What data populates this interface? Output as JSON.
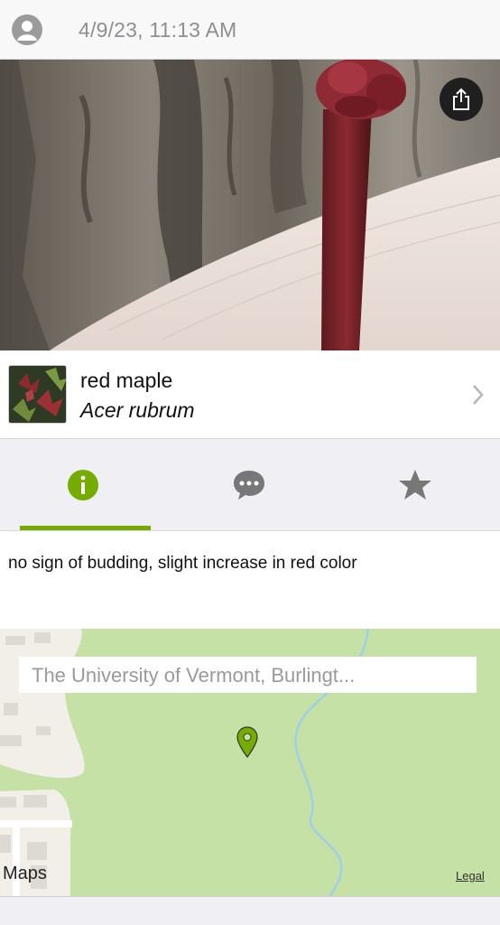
{
  "header": {
    "avatar_icon": "user-avatar-icon",
    "timestamp": "4/9/23, 11:13 AM"
  },
  "photo": {
    "share_icon": "share-icon"
  },
  "species": {
    "common_name": "red maple",
    "scientific_name": "Acer rubrum",
    "chevron_icon": "chevron-right-icon"
  },
  "tabs": [
    {
      "icon": "info-icon",
      "active": true,
      "color": "#74ac00"
    },
    {
      "icon": "comments-icon",
      "active": false,
      "color": "#777777"
    },
    {
      "icon": "star-icon",
      "active": false,
      "color": "#777777"
    }
  ],
  "notes": {
    "text": "no sign of budding, slight increase in red color"
  },
  "map": {
    "search_placeholder": "The University of Vermont, Burlingt...",
    "pin_icon": "map-pin-icon",
    "maps_label": "Maps",
    "legal_label": "Legal",
    "pin_color": "#74ac00"
  },
  "colors": {
    "accent": "#74ac00",
    "map_green": "#c5e1a5"
  }
}
